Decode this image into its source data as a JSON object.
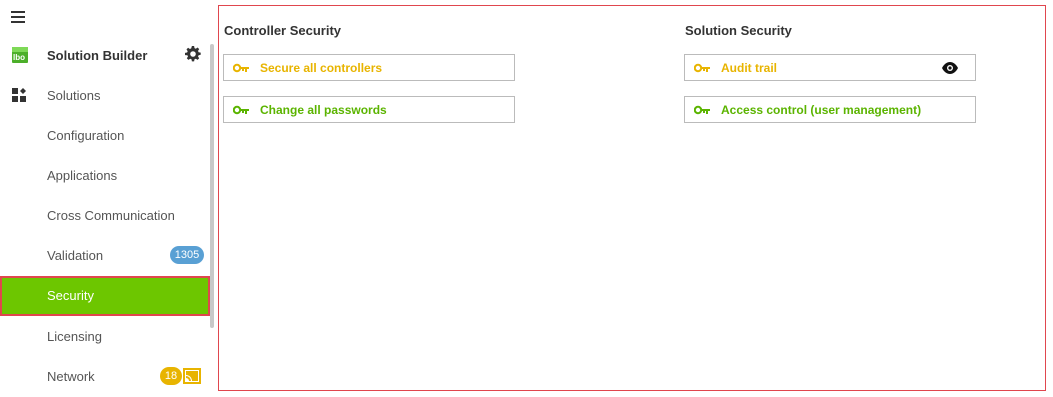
{
  "sidebar": {
    "title": "Solution Builder",
    "items": [
      {
        "label": "Solutions"
      },
      {
        "label": "Configuration"
      },
      {
        "label": "Applications"
      },
      {
        "label": "Cross Communication"
      },
      {
        "label": "Validation",
        "badge": "1305"
      },
      {
        "label": "Security"
      },
      {
        "label": "Licensing"
      },
      {
        "label": "Network",
        "badge": "18"
      }
    ]
  },
  "main": {
    "controller_security": {
      "title": "Controller Security",
      "actions": [
        {
          "label": "Secure all controllers"
        },
        {
          "label": "Change all passwords"
        }
      ]
    },
    "solution_security": {
      "title": "Solution Security",
      "actions": [
        {
          "label": "Audit trail"
        },
        {
          "label": "Access control (user management)"
        }
      ]
    }
  },
  "colors": {
    "accent_green": "#6dc600",
    "highlight_red": "#e0464e",
    "badge_blue": "#59a0d4",
    "badge_yellow": "#e8b400"
  },
  "icons": [
    "menu-icon",
    "solution-builder-logo",
    "gear-icon",
    "solutions-icon",
    "key-icon",
    "eye-icon",
    "cast-icon"
  ]
}
